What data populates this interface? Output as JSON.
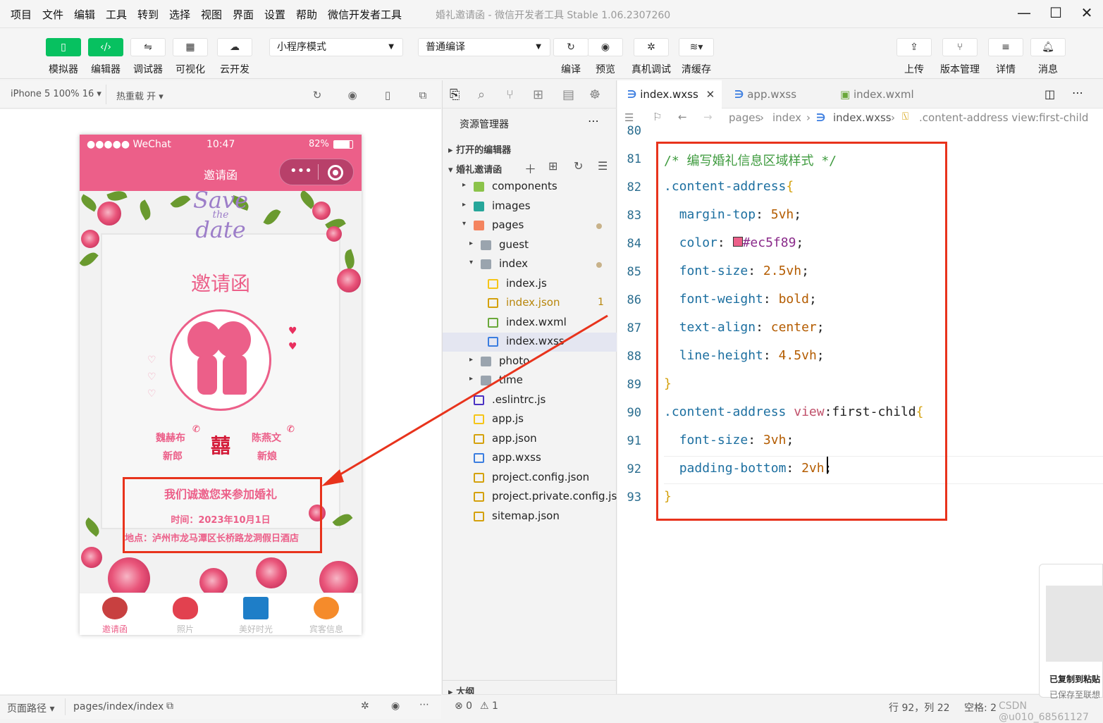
{
  "menu": [
    "项目",
    "文件",
    "编辑",
    "工具",
    "转到",
    "选择",
    "视图",
    "界面",
    "设置",
    "帮助",
    "微信开发者工具"
  ],
  "window_title": "婚礼邀请函 - 微信开发者工具 Stable 1.06.2307260",
  "toolbar": {
    "simulator": "模拟器",
    "editor": "编辑器",
    "debugger": "调试器",
    "visual": "可视化",
    "cloud": "云开发",
    "mode_select": "小程序模式",
    "compile_select": "普通编译",
    "compile": "编译",
    "preview": "预览",
    "real_debug": "真机调试",
    "clear_cache": "清缓存",
    "upload": "上传",
    "version": "版本管理",
    "details": "详情",
    "messages": "消息"
  },
  "simbar": {
    "device": "iPhone 5 100% 16 ▾",
    "hot_reload": "热重载 开 ▾"
  },
  "phone": {
    "signal": "●●●●● WeChat",
    "time": "10:47",
    "battery": "82%",
    "nav_title": "邀请函",
    "save_date_1": "Save",
    "save_date_2": "the",
    "save_date_3": "date",
    "heading": "邀请函",
    "groom_name": "魏赫布",
    "groom_label": "新郎",
    "bride_name": "陈燕文",
    "bride_label": "新娘",
    "double_happiness": "囍",
    "invite_title": "我们诚邀您来参加婚礼",
    "invite_time": "时间：2023年10月1日",
    "invite_address": "地点：泸州市龙马潭区长桥路龙洞假日酒店",
    "tabs": [
      "邀请函",
      "照片",
      "美好时光",
      "宾客信息"
    ]
  },
  "explorer": {
    "title": "资源管理器",
    "open_editors": "打开的编辑器",
    "project": "婚礼邀请函",
    "items": [
      {
        "name": "components",
        "indent": 0,
        "type": "folder-green",
        "arrow": "▸"
      },
      {
        "name": "images",
        "indent": 0,
        "type": "folder-teal",
        "arrow": "▸"
      },
      {
        "name": "pages",
        "indent": 0,
        "type": "folder-orange",
        "arrow": "▾",
        "dot": true
      },
      {
        "name": "guest",
        "indent": 1,
        "type": "folder",
        "arrow": "▸"
      },
      {
        "name": "index",
        "indent": 1,
        "type": "folder",
        "arrow": "▾",
        "dot": true
      },
      {
        "name": "index.js",
        "indent": 2,
        "type": "js"
      },
      {
        "name": "index.json",
        "indent": 2,
        "type": "json",
        "badge": "1"
      },
      {
        "name": "index.wxml",
        "indent": 2,
        "type": "wxml"
      },
      {
        "name": "index.wxss",
        "indent": 2,
        "type": "wxss",
        "selected": true
      },
      {
        "name": "photo",
        "indent": 1,
        "type": "folder",
        "arrow": "▸"
      },
      {
        "name": "time",
        "indent": 1,
        "type": "folder",
        "arrow": "▸"
      },
      {
        "name": ".eslintrc.js",
        "indent": 0,
        "type": "eslint"
      },
      {
        "name": "app.js",
        "indent": 0,
        "type": "js"
      },
      {
        "name": "app.json",
        "indent": 0,
        "type": "json"
      },
      {
        "name": "app.wxss",
        "indent": 0,
        "type": "wxss"
      },
      {
        "name": "project.config.json",
        "indent": 0,
        "type": "json"
      },
      {
        "name": "project.private.config.js...",
        "indent": 0,
        "type": "json"
      },
      {
        "name": "sitemap.json",
        "indent": 0,
        "type": "json"
      }
    ],
    "outline": "大纲"
  },
  "editor": {
    "tabs": [
      "index.wxss",
      "app.wxss",
      "index.wxml"
    ],
    "breadcrumb": [
      "pages",
      "index",
      "index.wxss",
      ".content-address view:first-child"
    ],
    "lines": [
      {
        "n": "80",
        "html": ""
      },
      {
        "n": "81",
        "html": "<span class='c-com'>/* 编写婚礼信息区域样式 */</span>"
      },
      {
        "n": "82",
        "html": "<span class='c-sel'>.content-address</span><span class='c-brace'>{</span>"
      },
      {
        "n": "83",
        "html": "  <span class='c-prop'>margin-top</span>: <span class='c-val'>5vh</span>;"
      },
      {
        "n": "84",
        "html": "  <span class='c-prop'>color</span>: <span style='display:inline-block;width:14px;height:14px;background:#ec5f89;border:1px solid #333'></span><span class='c-pseudo'>#ec5f89</span>;"
      },
      {
        "n": "85",
        "html": "  <span class='c-prop'>font-size</span>: <span class='c-val'>2.5vh</span>;"
      },
      {
        "n": "86",
        "html": "  <span class='c-prop'>font-weight</span>: <span class='c-val'>bold</span>;"
      },
      {
        "n": "87",
        "html": "  <span class='c-prop'>text-align</span>: <span class='c-val'>center</span>;"
      },
      {
        "n": "88",
        "html": "  <span class='c-prop'>line-height</span>: <span class='c-val'>4.5vh</span>;"
      },
      {
        "n": "89",
        "html": "<span class='c-brace'>}</span>"
      },
      {
        "n": "90",
        "html": "<span class='c-sel'>.content-address</span> <span class='c-pseudo' style='color:#c0506a'>view</span>:first-child<span class='c-brace'>{</span>"
      },
      {
        "n": "91",
        "html": "  <span class='c-prop'>font-size</span>: <span class='c-val'>3vh</span>;"
      },
      {
        "n": "92",
        "html": "  <span class='c-prop'>padding-bottom</span>: <span class='c-val'>2vh</span>;"
      },
      {
        "n": "93",
        "html": "<span class='c-brace'>}</span>"
      }
    ]
  },
  "footer": {
    "page_path_label": "页面路径 ▾",
    "page_path": "pages/index/index",
    "errors": "⊗ 0",
    "warnings": "⚠ 1",
    "cursor": "行 92，列 22",
    "encoding": "空格: 2",
    "watermark": "CSDN @u010_68561127"
  },
  "toast": {
    "title": "已复制到粘贴",
    "sub": "已保存至联想"
  }
}
